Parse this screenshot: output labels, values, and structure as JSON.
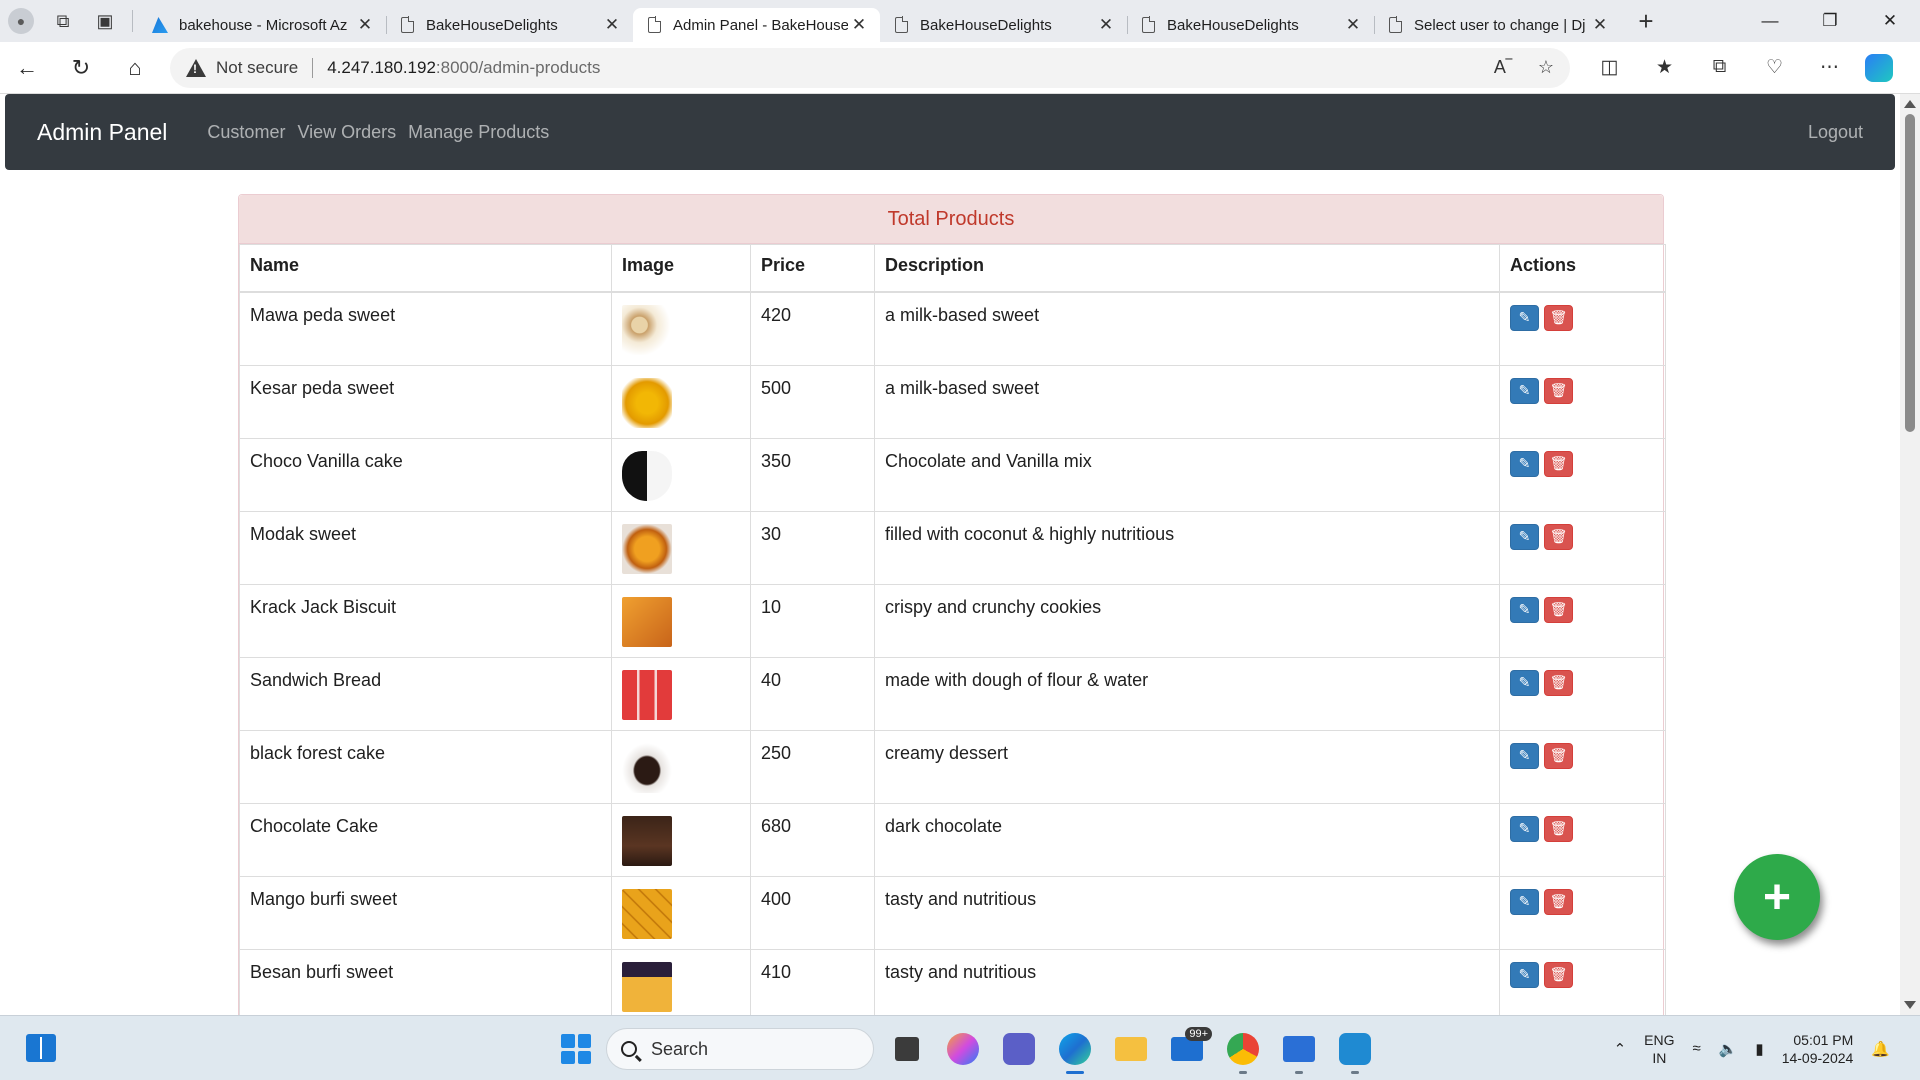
{
  "browser": {
    "tabs": [
      {
        "title": "bakehouse - Microsoft Az",
        "icon": "azure-icon",
        "active": false
      },
      {
        "title": "BakeHouseDelights",
        "icon": "page-icon",
        "active": false
      },
      {
        "title": "Admin Panel - BakeHouse",
        "icon": "page-icon",
        "active": true
      },
      {
        "title": "BakeHouseDelights",
        "icon": "page-icon",
        "active": false
      },
      {
        "title": "BakeHouseDelights",
        "icon": "page-icon",
        "active": false
      },
      {
        "title": "Select user to change | Dj",
        "icon": "page-icon",
        "active": false
      }
    ],
    "address": {
      "security": "Not secure",
      "host": "4.247.180.192",
      "path": ":8000/admin-products"
    }
  },
  "navbar": {
    "brand": "Admin Panel",
    "links": [
      "Customer",
      "View Orders",
      "Manage Products"
    ],
    "logout": "Logout"
  },
  "panel": {
    "title": "Total Products",
    "columns": [
      "Name",
      "Image",
      "Price",
      "Description",
      "Actions"
    ],
    "rows": [
      {
        "name": "Mawa peda sweet",
        "price": "420",
        "description": "a milk-based sweet",
        "image": "mawa-peda-image"
      },
      {
        "name": "Kesar peda sweet",
        "price": "500",
        "description": "a milk-based sweet",
        "image": "kesar-peda-image"
      },
      {
        "name": "Choco Vanilla cake",
        "price": "350",
        "description": "Chocolate and Vanilla mix",
        "image": "choco-vanilla-cake-image"
      },
      {
        "name": "Modak sweet",
        "price": "30",
        "description": "filled with coconut & highly nutritious",
        "image": "modak-image"
      },
      {
        "name": "Krack Jack Biscuit",
        "price": "10",
        "description": "crispy and crunchy cookies",
        "image": "krack-jack-image"
      },
      {
        "name": "Sandwich Bread",
        "price": "40",
        "description": "made with dough of flour & water",
        "image": "sandwich-bread-image"
      },
      {
        "name": "black forest cake",
        "price": "250",
        "description": "creamy dessert",
        "image": "black-forest-cake-image"
      },
      {
        "name": "Chocolate Cake",
        "price": "680",
        "description": "dark chocolate",
        "image": "chocolate-cake-image"
      },
      {
        "name": "Mango burfi sweet",
        "price": "400",
        "description": "tasty and nutritious",
        "image": "mango-burfi-image"
      },
      {
        "name": "Besan burfi sweet",
        "price": "410",
        "description": "tasty and nutritious",
        "image": "besan-burfi-image"
      }
    ],
    "actions": {
      "edit_icon": "edit-icon",
      "delete_icon": "trash-icon"
    }
  },
  "fab": {
    "icon": "plus-icon"
  },
  "taskbar": {
    "search_placeholder": "Search",
    "mail_badge": "99+",
    "language": {
      "line1": "ENG",
      "line2": "IN"
    },
    "clock": {
      "time": "05:01 PM",
      "date": "14-09-2024"
    }
  },
  "colors": {
    "navbar_bg": "#343a40",
    "panel_head_bg": "#f2dede",
    "panel_head_text": "#c0392b",
    "edit_button": "#337ab7",
    "delete_button": "#d9534f",
    "fab": "#2eaa4a"
  }
}
